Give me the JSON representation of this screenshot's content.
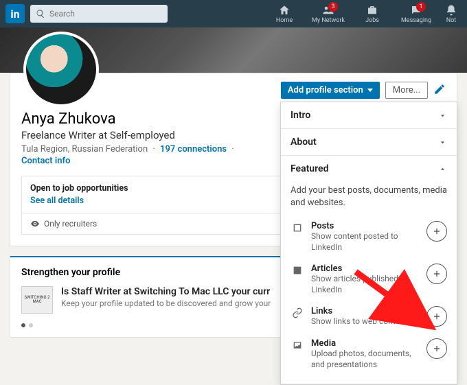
{
  "nav": {
    "search_placeholder": "Search",
    "items": [
      {
        "label": "Home"
      },
      {
        "label": "My Network",
        "badge": "3"
      },
      {
        "label": "Jobs"
      },
      {
        "label": "Messaging",
        "badge": "1"
      },
      {
        "label": "Not"
      }
    ]
  },
  "actions": {
    "add_section": "Add profile section",
    "more": "More..."
  },
  "profile": {
    "name": "Anya Zhukova",
    "headline": "Freelance Writer at Self-employed",
    "location": "Tula Region, Russian Federation",
    "connections": "197 connections",
    "contact": "Contact info"
  },
  "opportunities": {
    "title": "Open to job opportunities",
    "see_all": "See all details",
    "visibility": "Only recruiters"
  },
  "strengthen": {
    "heading": "Strengthen your profile",
    "thumb_text": "SWITCHING 2 MAC",
    "item_title": "Is Staff Writer at Switching To Mac LLC your curr",
    "item_sub": "Keep your profile updated to be discovered and grow your"
  },
  "dropdown": {
    "intro": "Intro",
    "about": "About",
    "featured": {
      "label": "Featured",
      "desc": "Add your best posts, documents, media and websites.",
      "items": [
        {
          "title": "Posts",
          "desc": "Show content posted to LinkedIn"
        },
        {
          "title": "Articles",
          "desc": "Show articles published on LinkedIn"
        },
        {
          "title": "Links",
          "desc": "Show links to web content"
        },
        {
          "title": "Media",
          "desc": "Upload photos, documents, and presentations"
        }
      ]
    }
  }
}
